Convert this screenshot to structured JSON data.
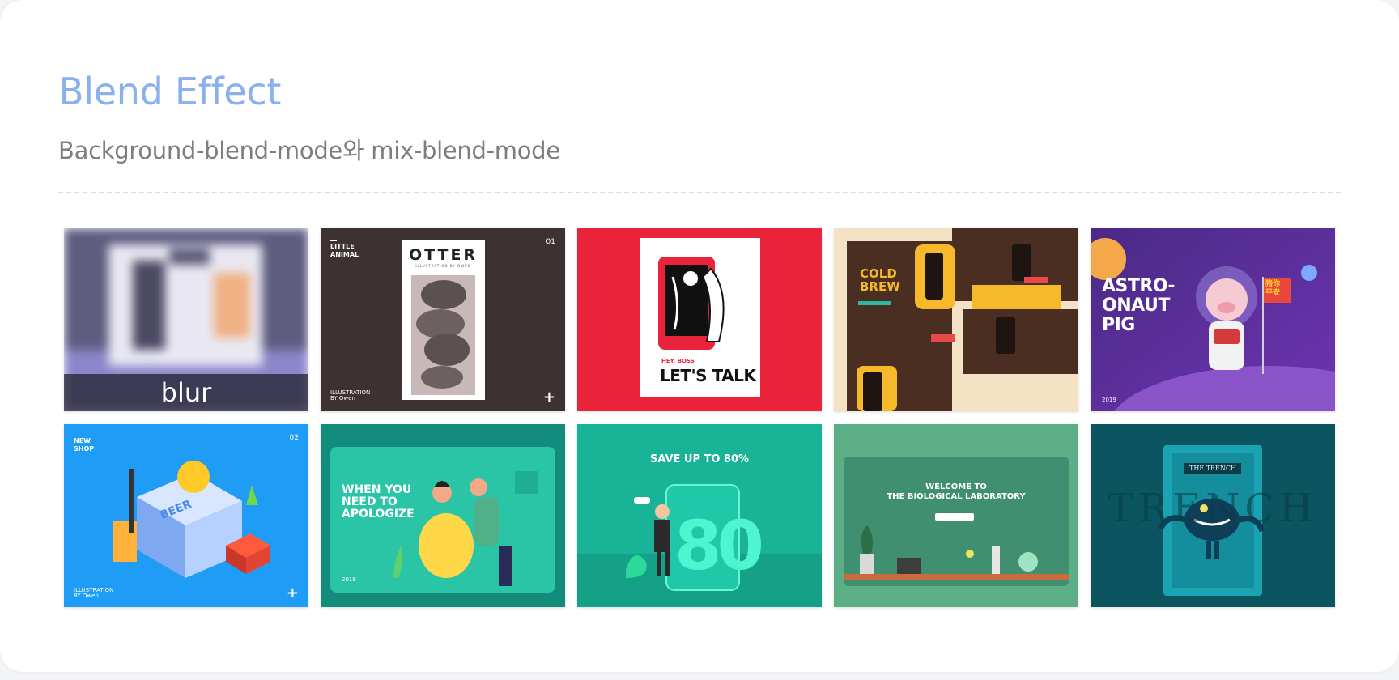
{
  "header": {
    "title": "Blend Effect",
    "subtitle": "Background-blend-mode와 mix-blend-mode"
  },
  "tiles": [
    {
      "caption": "blur",
      "accent": "#5e5c7f"
    },
    {
      "kicker": "LITTLE\nANIMAL",
      "heading": "OTTER",
      "subheading": "ILLUSTRATION BY OWEN",
      "page": "01",
      "footer": "ILLUSTRATION\nBY Owen",
      "accent": "#3d3131"
    },
    {
      "kicker": "HEY, BOSS",
      "heading": "LET'S TALK",
      "accent": "#e8233a"
    },
    {
      "heading": "COLD\nBREW",
      "accent": "#f6b92c"
    },
    {
      "heading": "ASTRO-\nONAUT\nPIG",
      "flag": "猪你\n平安",
      "year": "2019",
      "accent": "#5b2a8c"
    },
    {
      "kicker": "NEW\nSHOP",
      "sign": "BEER",
      "page": "02",
      "footer": "ILLUSTRATION\nBY Owen",
      "accent": "#1e9cf6"
    },
    {
      "heading": "WHEN YOU\nNEED TO\nAPOLOGIZE",
      "year": "2019",
      "accent": "#1f9e8e"
    },
    {
      "heading": "SAVE UP TO 80%",
      "number": "80",
      "accent": "#19b397"
    },
    {
      "heading": "WELCOME TO\nTHE BIOLOGICAL LABORATORY",
      "accent": "#3f8f70"
    },
    {
      "heading": "THE TRENCH",
      "watermark": "TRENCH",
      "accent": "#0b5560"
    }
  ]
}
